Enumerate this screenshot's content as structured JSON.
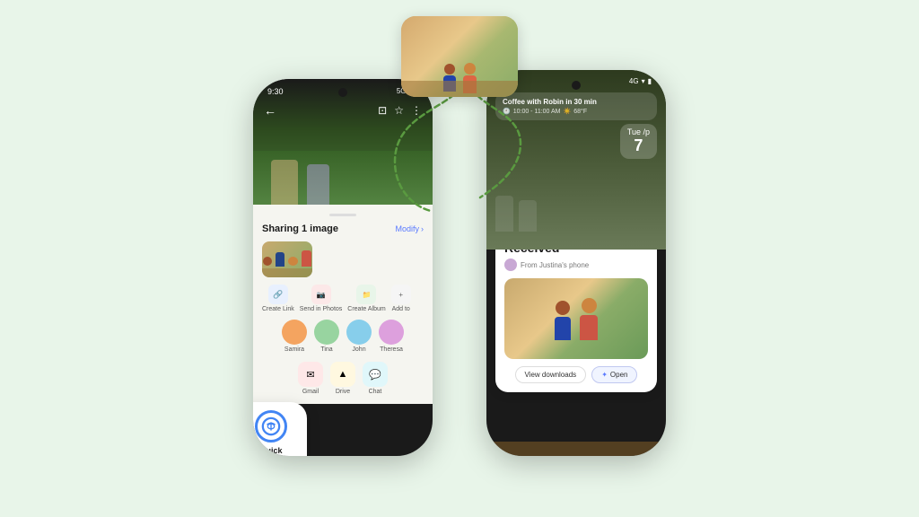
{
  "scene": {
    "background": "#e8f5e9"
  },
  "floating_image": {
    "alt": "Two people at table"
  },
  "left_phone": {
    "status_bar": {
      "time": "9:30",
      "signal": "5G"
    },
    "nav": {
      "back": "←",
      "icons": "⊡ ☆ ⋮"
    },
    "share": {
      "title": "Sharing 1 image",
      "modify": "Modify",
      "actions": [
        {
          "icon": "🔗",
          "label": "Create Link"
        },
        {
          "icon": "📷",
          "label": "Send in Photos"
        },
        {
          "icon": "📁",
          "label": "Create Album"
        },
        {
          "icon": "+",
          "label": "Add to"
        }
      ],
      "contacts": [
        {
          "name": "Samira",
          "color": "#f4a460"
        },
        {
          "name": "Tina",
          "color": "#98d4a0"
        },
        {
          "name": "John",
          "color": "#87ceeb"
        },
        {
          "name": "Theresa",
          "color": "#dda0dd"
        }
      ],
      "apps": [
        {
          "icon": "✉",
          "name": "Gmail",
          "color": "#f44336"
        },
        {
          "icon": "▲",
          "name": "Drive",
          "color": "#fbbc04"
        },
        {
          "icon": "💬",
          "name": "Chat",
          "color": "#00bcd4"
        }
      ]
    }
  },
  "quick_share": {
    "label": "Quick\nShare"
  },
  "right_phone": {
    "status_bar": {
      "signal": "4G"
    },
    "calendar": {
      "title": "Coffee with Robin in 30 min",
      "time": "10:00 - 11:00 AM",
      "weather": "68°F"
    },
    "date_badge": "Tue /p",
    "received": {
      "title": "Received",
      "from": "From Justina's phone"
    },
    "buttons": {
      "downloads": "View downloads",
      "open": "Open"
    }
  }
}
